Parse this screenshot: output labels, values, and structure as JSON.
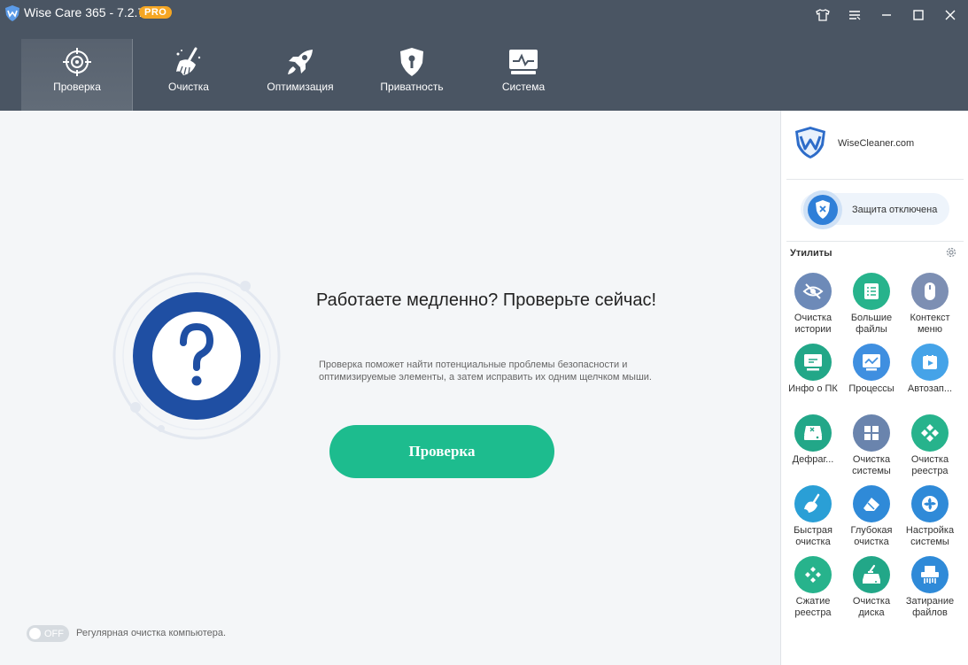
{
  "window": {
    "title": "Wise Care 365 - 7.2.7",
    "badge": "PRO"
  },
  "nav": {
    "tabs": [
      {
        "label": "Проверка",
        "icon": "crosshair-icon",
        "active": true
      },
      {
        "label": "Очистка",
        "icon": "broom-icon",
        "active": false
      },
      {
        "label": "Оптимизация",
        "icon": "rocket-icon",
        "active": false
      },
      {
        "label": "Приватность",
        "icon": "shield-keyhole-icon",
        "active": false
      },
      {
        "label": "Система",
        "icon": "monitor-pulse-icon",
        "active": false
      }
    ]
  },
  "main": {
    "headline": "Работаете медленно? Проверьте сейчас!",
    "description": "Проверка поможет найти потенциальные проблемы безопасности и оптимизируемые элементы, а затем исправить их одним щелчком мыши.",
    "scan_button": "Проверка",
    "schedule_toggle_state": "OFF",
    "schedule_label": "Регулярная очистка компьютера."
  },
  "sidebar": {
    "brand": "WiseCleaner.com",
    "protection_status": "Защита отключена",
    "utilities_title": "Утилиты",
    "utilities": [
      {
        "label": "Очистка\nистории",
        "icon": "eye-slash-icon",
        "color": "#6d8ab8"
      },
      {
        "label": "Большие\nфайлы",
        "icon": "document-list-icon",
        "color": "#27b38c"
      },
      {
        "label": "Контекст\nменю",
        "icon": "mouse-icon",
        "color": "#7d8fb3"
      },
      {
        "label": "Инфо о ПК",
        "icon": "monitor-icon",
        "color": "#22a788"
      },
      {
        "label": "Процессы",
        "icon": "activity-chart-icon",
        "color": "#3f8fe0"
      },
      {
        "label": "Автозап...",
        "icon": "play-icon",
        "color": "#45a3e8"
      },
      {
        "label": "Дефраг...",
        "icon": "hard-drive-icon",
        "color": "#22a788"
      },
      {
        "label": "Очистка\nсистемы",
        "icon": "windows-logo-icon",
        "color": "#6a84ad"
      },
      {
        "label": "Очистка\nреестра",
        "icon": "registry-cubes-icon",
        "color": "#27b38c"
      },
      {
        "label": "Быстрая\nочистка",
        "icon": "brush-icon",
        "color": "#2a9fd6"
      },
      {
        "label": "Глубокая\nочистка",
        "icon": "eraser-icon",
        "color": "#2f8ad8"
      },
      {
        "label": "Настройка\nсистемы",
        "icon": "gear-fan-icon",
        "color": "#2f8ad8"
      },
      {
        "label": "Сжатие\nреестра",
        "icon": "compress-cubes-icon",
        "color": "#27b38c"
      },
      {
        "label": "Очистка\nдиска",
        "icon": "disk-clean-icon",
        "color": "#22a788"
      },
      {
        "label": "Затирание\nфайлов",
        "icon": "shredder-icon",
        "color": "#2f8ad8"
      }
    ]
  }
}
